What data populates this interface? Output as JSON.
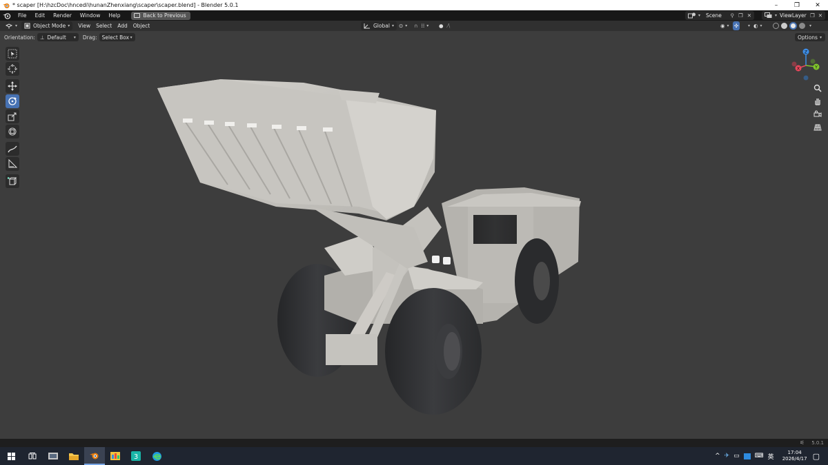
{
  "window": {
    "title": "* scaper [H:\\hzcDoc\\hncedi\\hunanZhenxiang\\scaper\\scaper.blend] - Blender 5.0.1",
    "minimize": "–",
    "maximize": "❐",
    "close": "✕"
  },
  "menu": {
    "items": [
      "File",
      "Edit",
      "Render",
      "Window",
      "Help"
    ],
    "back_button": "Back to Previous",
    "scene_label": "Scene",
    "view_layer_label": "ViewLayer"
  },
  "viewport_header": {
    "mode": "Object Mode",
    "menus": [
      "View",
      "Select",
      "Add",
      "Object"
    ],
    "transform_orientation": "Global"
  },
  "tool_settings": {
    "orientation_label": "Orientation:",
    "orientation_value": "Default",
    "drag_label": "Drag:",
    "drag_value": "Select Box",
    "options_label": "Options"
  },
  "gizmo": {
    "x": "X",
    "y": "Y",
    "z": "Z",
    "colors": {
      "x": "#e8485c",
      "y": "#80c62b",
      "z": "#3d8ee8"
    }
  },
  "toolbar": {
    "tools": [
      {
        "name": "select-box-tool-icon",
        "active": false
      },
      {
        "name": "cursor-tool-icon",
        "active": false
      },
      {
        "name": "move-tool-icon",
        "active": false
      },
      {
        "name": "rotate-tool-icon",
        "active": true
      },
      {
        "name": "scale-tool-icon",
        "active": false
      },
      {
        "name": "transform-tool-icon",
        "active": false
      },
      {
        "name": "annotate-tool-icon",
        "active": false
      },
      {
        "name": "measure-tool-icon",
        "active": false
      },
      {
        "name": "add-cube-tool-icon",
        "active": false
      }
    ]
  },
  "status": {
    "version": "5.0.1"
  },
  "taskbar": {
    "time": "17:04",
    "date": "2026/4/17",
    "ime": "英",
    "apps": [
      "start-icon",
      "task-view-icon",
      "file-explorer-icon",
      "folder-icon",
      "blender-icon",
      "app-icon",
      "app-3-icon",
      "edge-icon"
    ]
  },
  "colors": {
    "accent": "#4772b3",
    "viewport_bg": "#3d3d3d",
    "header_bg": "#303030",
    "topbar_bg": "#181818"
  }
}
